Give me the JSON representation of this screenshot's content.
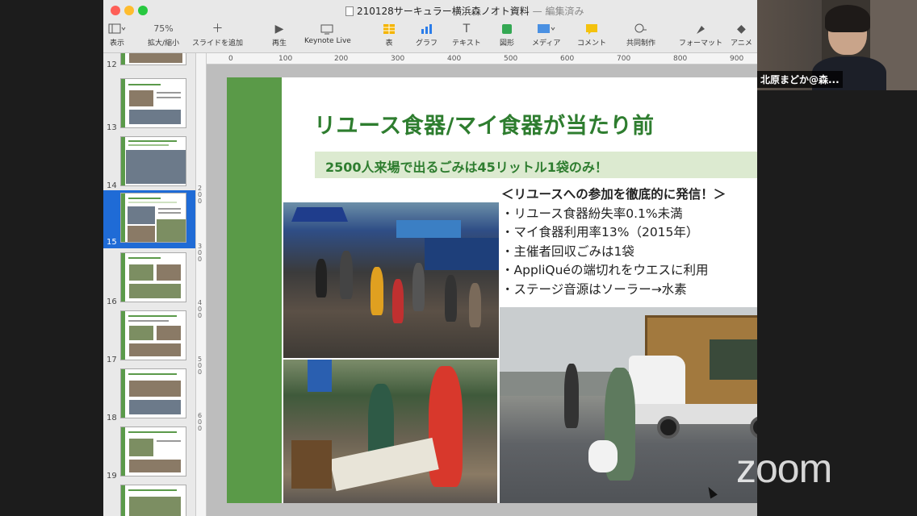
{
  "window": {
    "title": "210128サーキュラー横浜森ノオト資料",
    "edited_status": "— 編集済み"
  },
  "toolbar": {
    "items": [
      {
        "label": "表示",
        "icon": "sidebar-icon"
      },
      {
        "label": "75%",
        "icon": "zoom-value"
      },
      {
        "label": "拡大/縮小",
        "icon": "zoom-icon"
      },
      {
        "label": "スライドを追加",
        "icon": "plus-icon"
      },
      {
        "label": "再生",
        "icon": "play-icon"
      },
      {
        "label": "Keynote Live",
        "icon": "keynote-live-icon"
      },
      {
        "label": "表",
        "icon": "table-icon"
      },
      {
        "label": "グラフ",
        "icon": "chart-icon"
      },
      {
        "label": "テキスト",
        "icon": "text-icon"
      },
      {
        "label": "図形",
        "icon": "shape-icon"
      },
      {
        "label": "メディア",
        "icon": "media-icon"
      },
      {
        "label": "コメント",
        "icon": "comment-icon"
      },
      {
        "label": "共同制作",
        "icon": "collaborate-icon"
      },
      {
        "label": "フォーマット",
        "icon": "format-icon"
      },
      {
        "label": "アニメ",
        "icon": "animate-icon"
      }
    ]
  },
  "navigator": {
    "slides": [
      {
        "number": "12"
      },
      {
        "number": "13"
      },
      {
        "number": "14"
      },
      {
        "number": "15",
        "selected": true
      },
      {
        "number": "16"
      },
      {
        "number": "17"
      },
      {
        "number": "18"
      },
      {
        "number": "19"
      }
    ]
  },
  "ruler": {
    "h_ticks": [
      "0",
      "100",
      "200",
      "300",
      "400",
      "500",
      "600",
      "700",
      "800",
      "900"
    ],
    "v_ticks": [
      "200",
      "300",
      "400",
      "500",
      "600"
    ]
  },
  "slide": {
    "title": "リユース食器/マイ食器が当たり前",
    "subtitle": "2500人来場で出るごみは45リットル1袋のみ！",
    "points_heading": "＜リユースへの参加を徹底的に発信！＞",
    "points": [
      "・リユース食器紛失率0.1%未満",
      "・マイ食器利用率13%（2015年）",
      "・主催者回収ごみは1袋",
      "・AppliQuéの端切れをウエスに利用",
      "・ステージ音源はソーラー→水素"
    ]
  },
  "participant": {
    "name": "北原まどか@森..."
  },
  "watermark": "zoom"
}
